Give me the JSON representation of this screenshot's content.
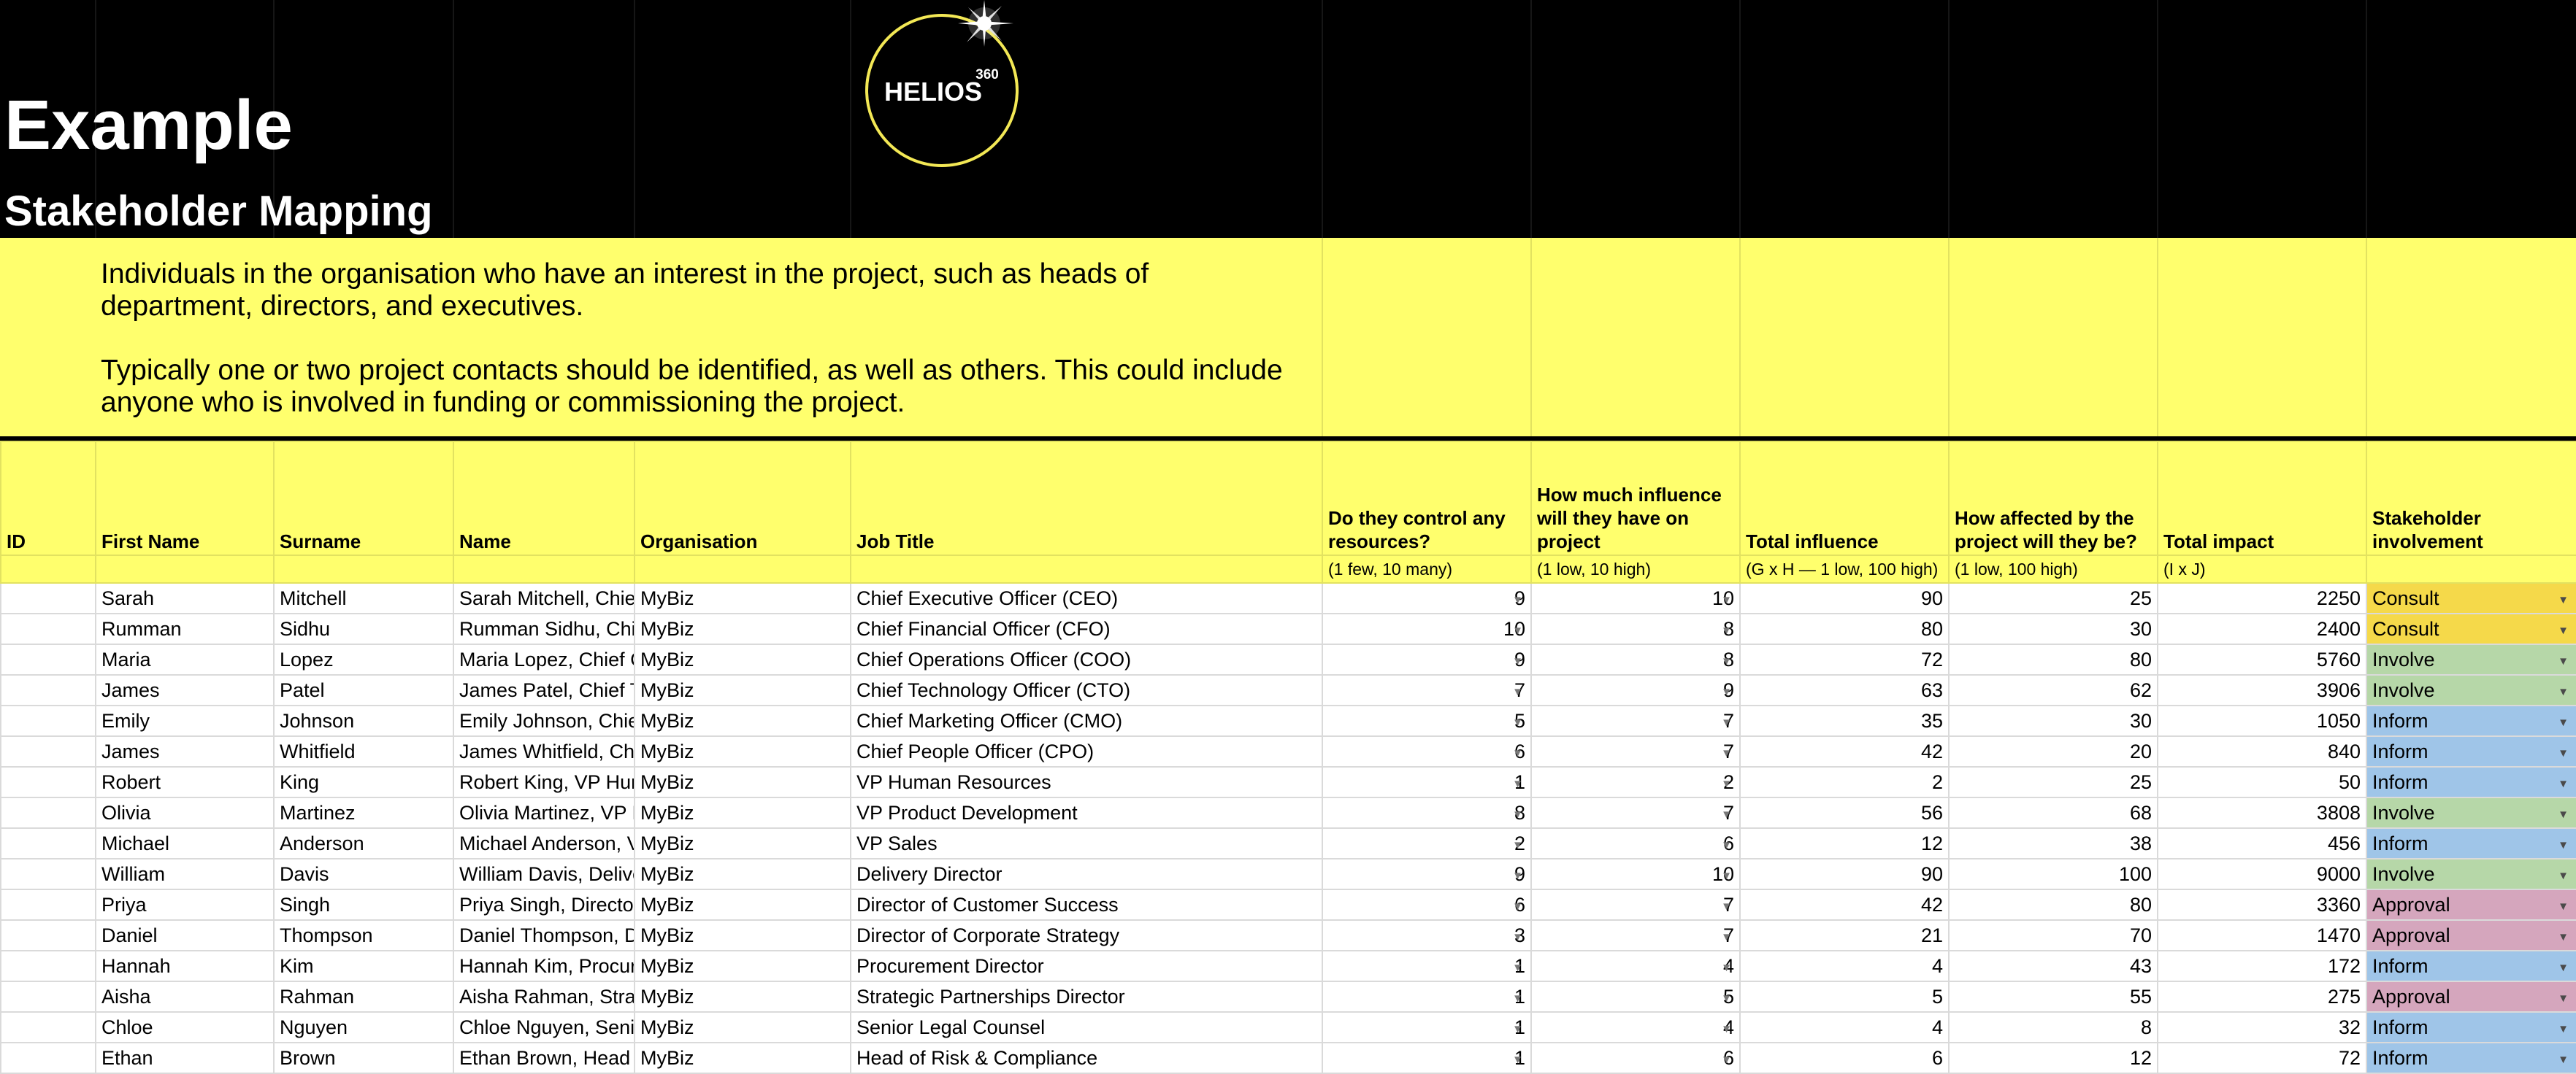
{
  "header": {
    "title": "Example",
    "subtitle": "Stakeholder Mapping",
    "logo_text": "HELIOS",
    "logo_superscript": "360"
  },
  "description": {
    "paragraph1": "Individuals in the organisation who have an interest in the project, such as heads of department, directors, and executives.",
    "paragraph2": "Typically one or two project contacts should be identified, as well as others. This could include anyone who is involved in funding or commissioning the project."
  },
  "columns": {
    "id": "ID",
    "first_name": "First Name",
    "surname": "Surname",
    "name": "Name",
    "organisation": "Organisation",
    "job_title": "Job Title",
    "resources": "Do they control any resources?",
    "influence": "How much influence will they have on project",
    "total_influence": "Total influence",
    "affected": "How affected by the project will they be?",
    "total_impact": "Total impact",
    "involvement": "Stakeholder involvement"
  },
  "scales": {
    "resources": "(1 few, 10 many)",
    "influence": "(1 low, 10 high)",
    "total_influence": "(G x H  — 1 low, 100 high)",
    "affected": "(1 low, 100 high)",
    "total_impact": "(I x J)"
  },
  "involvement_colors": {
    "Consult": "#f5d94a",
    "Involve": "#b6d7a8",
    "Inform": "#9fc5e8",
    "Approval": "#d5a6bd"
  },
  "rows": [
    {
      "id": "",
      "first": "Sarah",
      "surname": "Mitchell",
      "name": "Sarah Mitchell, Chief",
      "org": "MyBiz",
      "job": "Chief Executive Officer (CEO)",
      "resources": 9,
      "influence": 10,
      "total_influence": 90,
      "affected": 25,
      "total_impact": 2250,
      "involvement": "Consult"
    },
    {
      "id": "",
      "first": "Rumman",
      "surname": "Sidhu",
      "name": "Rumman Sidhu, Chie",
      "org": "MyBiz",
      "job": "Chief Financial Officer (CFO)",
      "resources": 10,
      "influence": 8,
      "total_influence": 80,
      "affected": 30,
      "total_impact": 2400,
      "involvement": "Consult"
    },
    {
      "id": "",
      "first": "Maria",
      "surname": "Lopez",
      "name": "Maria Lopez, Chief C",
      "org": "MyBiz",
      "job": "Chief Operations Officer (COO)",
      "resources": 9,
      "influence": 8,
      "total_influence": 72,
      "affected": 80,
      "total_impact": 5760,
      "involvement": "Involve"
    },
    {
      "id": "",
      "first": "James",
      "surname": "Patel",
      "name": "James Patel, Chief T",
      "org": "MyBiz",
      "job": "Chief Technology Officer (CTO)",
      "resources": 7,
      "influence": 9,
      "total_influence": 63,
      "affected": 62,
      "total_impact": 3906,
      "involvement": "Involve"
    },
    {
      "id": "",
      "first": "Emily",
      "surname": "Johnson",
      "name": "Emily Johnson, Chie",
      "org": "MyBiz",
      "job": "Chief Marketing Officer (CMO)",
      "resources": 5,
      "influence": 7,
      "total_influence": 35,
      "affected": 30,
      "total_impact": 1050,
      "involvement": "Inform"
    },
    {
      "id": "",
      "first": "James",
      "surname": "Whitfield",
      "name": "James Whitfield, Chi",
      "org": "MyBiz",
      "job": "Chief People Officer (CPO)",
      "resources": 6,
      "influence": 7,
      "total_influence": 42,
      "affected": 20,
      "total_impact": 840,
      "involvement": "Inform"
    },
    {
      "id": "",
      "first": "Robert",
      "surname": "King",
      "name": "Robert King, VP Hun",
      "org": "MyBiz",
      "job": "VP Human Resources",
      "resources": 1,
      "influence": 2,
      "total_influence": 2,
      "affected": 25,
      "total_impact": 50,
      "involvement": "Inform"
    },
    {
      "id": "",
      "first": "Olivia",
      "surname": "Martinez",
      "name": "Olivia Martinez, VP F",
      "org": "MyBiz",
      "job": "VP Product Development",
      "resources": 8,
      "influence": 7,
      "total_influence": 56,
      "affected": 68,
      "total_impact": 3808,
      "involvement": "Involve"
    },
    {
      "id": "",
      "first": "Michael",
      "surname": "Anderson",
      "name": "Michael Anderson, V",
      "org": "MyBiz",
      "job": "VP Sales",
      "resources": 2,
      "influence": 6,
      "total_influence": 12,
      "affected": 38,
      "total_impact": 456,
      "involvement": "Inform"
    },
    {
      "id": "",
      "first": "William",
      "surname": "Davis",
      "name": "William Davis, Delive",
      "org": "MyBiz",
      "job": "Delivery Director",
      "resources": 9,
      "influence": 10,
      "total_influence": 90,
      "affected": 100,
      "total_impact": 9000,
      "involvement": "Involve"
    },
    {
      "id": "",
      "first": "Priya",
      "surname": "Singh",
      "name": "Priya Singh, Director",
      "org": "MyBiz",
      "job": "Director of Customer Success",
      "resources": 6,
      "influence": 7,
      "total_influence": 42,
      "affected": 80,
      "total_impact": 3360,
      "involvement": "Approval"
    },
    {
      "id": "",
      "first": "Daniel",
      "surname": "Thompson",
      "name": "Daniel Thompson, D",
      "org": "MyBiz",
      "job": "Director of Corporate Strategy",
      "resources": 3,
      "influence": 7,
      "total_influence": 21,
      "affected": 70,
      "total_impact": 1470,
      "involvement": "Approval"
    },
    {
      "id": "",
      "first": "Hannah",
      "surname": "Kim",
      "name": "Hannah Kim, Procur",
      "org": "MyBiz",
      "job": "Procurement Director",
      "resources": 1,
      "influence": 4,
      "total_influence": 4,
      "affected": 43,
      "total_impact": 172,
      "involvement": "Inform"
    },
    {
      "id": "",
      "first": "Aisha",
      "surname": "Rahman",
      "name": "Aisha Rahman, Strat",
      "org": "MyBiz",
      "job": "Strategic Partnerships Director",
      "resources": 1,
      "influence": 5,
      "total_influence": 5,
      "affected": 55,
      "total_impact": 275,
      "involvement": "Approval"
    },
    {
      "id": "",
      "first": "Chloe",
      "surname": "Nguyen",
      "name": "Chloe Nguyen, Senic",
      "org": "MyBiz",
      "job": "Senior Legal Counsel",
      "resources": 1,
      "influence": 4,
      "total_influence": 4,
      "affected": 8,
      "total_impact": 32,
      "involvement": "Inform"
    },
    {
      "id": "",
      "first": "Ethan",
      "surname": "Brown",
      "name": "Ethan Brown, Head c",
      "org": "MyBiz",
      "job": "Head of Risk & Compliance",
      "resources": 1,
      "influence": 6,
      "total_influence": 6,
      "affected": 12,
      "total_impact": 72,
      "involvement": "Inform"
    }
  ]
}
